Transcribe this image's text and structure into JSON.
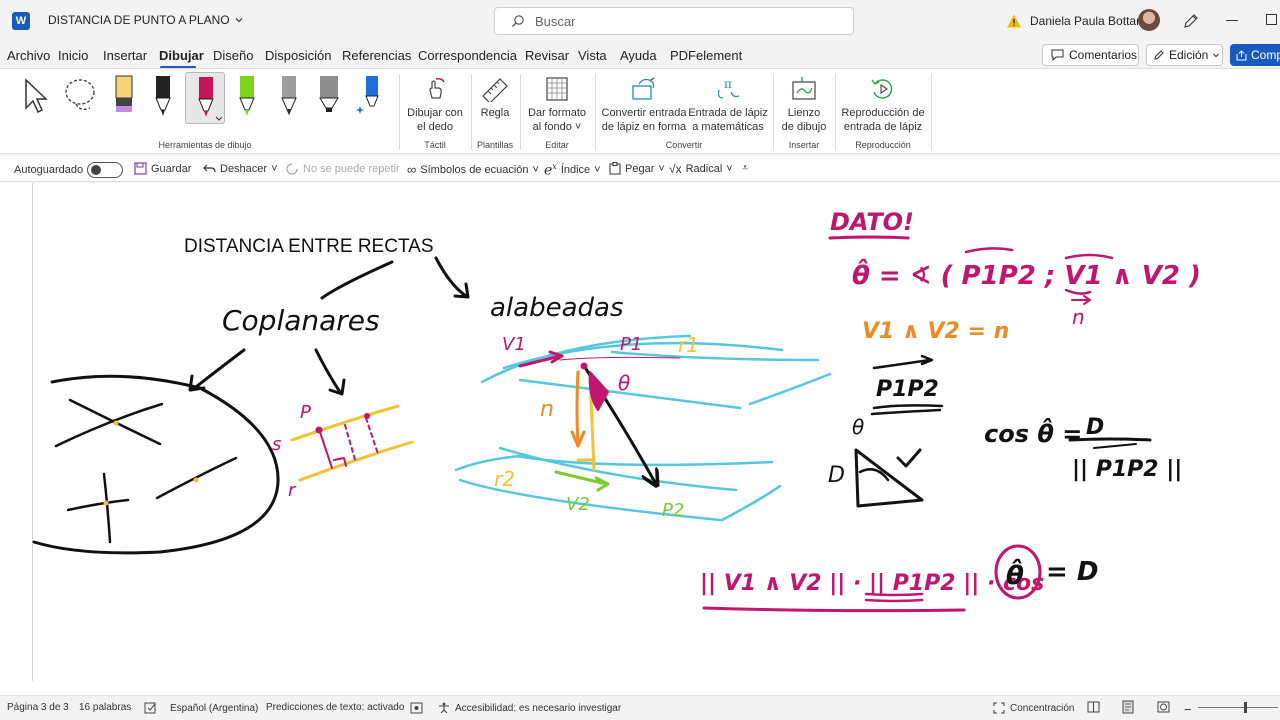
{
  "app": {
    "logo": "W",
    "doc_title": "DISTANCIA DE PUNTO A PLANO",
    "search_placeholder": "Buscar",
    "user_name": "Daniela Paula Bottaro"
  },
  "menu": {
    "tabs": [
      "Archivo",
      "Inicio",
      "Insertar",
      "Dibujar",
      "Diseño",
      "Disposición",
      "Referencias",
      "Correspondencia",
      "Revisar",
      "Vista",
      "Ayuda",
      "PDFelement"
    ],
    "active_tab": "Dibujar",
    "comments_label": "Comentarios",
    "edit_label": "Edición",
    "share_label": "Comp"
  },
  "ribbon": {
    "groups": {
      "herramientas": "Herramientas de dibujo",
      "tactil": "Táctil",
      "plantillas": "Plantillas",
      "editar": "Editar",
      "convertir": "Convertir",
      "insertar": "Insertar",
      "reproduccion": "Reproducción"
    },
    "buttons": {
      "dibujar_dedo_1": "Dibujar con",
      "dibujar_dedo_2": "el dedo",
      "regla": "Regla",
      "dar_formato_1": "Dar formato",
      "dar_formato_2": "al fondo",
      "convertir_forma_1": "Convertir entrada",
      "convertir_forma_2": "de lápiz en forma",
      "entrada_mate_1": "Entrada de lápiz",
      "entrada_mate_2": "a matemáticas",
      "lienzo_1": "Lienzo",
      "lienzo_2": "de dibujo",
      "reproduccion_1": "Reproducción de",
      "reproduccion_2": "entrada de lápiz"
    },
    "pen_colors": [
      "#f5d37a",
      "#c2185b",
      "#7ed321",
      "#9e9e9e",
      "#8e8e8e",
      "#1e6fd9"
    ]
  },
  "qat": {
    "autoguardado": "Autoguardado",
    "guardar": "Guardar",
    "deshacer": "Deshacer",
    "rehacer": "No se puede repetir",
    "simbolos": "Símbolos de ecuación",
    "indice": "Índice",
    "pegar": "Pegar",
    "radical": "Radical"
  },
  "document": {
    "heading": "DISTANCIA ENTRE RECTAS",
    "ink_colors": {
      "magenta": "#c0166e",
      "orange": "#f08a24",
      "cyan": "#56c7dd",
      "yellow": "#f2c23a",
      "green": "#7ccc2e",
      "black": "#111111"
    },
    "handwriting": {
      "coplanares": "Coplanares",
      "alabeadas": "alabeadas",
      "v1": "V1",
      "p1": "P1",
      "r1": "r1",
      "theta": "θ",
      "n": "n",
      "r2": "r2",
      "v2": "V2",
      "p2": "P2",
      "P": "P",
      "s": "s",
      "r": "r",
      "dato": "DATO!",
      "theta_hat_def": "θ̂ = ∢ ( P1P2 ; V1 ∧ V2 )",
      "n_under": "n",
      "cross_eq": "V1 ∧ V2 = n",
      "p1p2": "P1P2",
      "tri_theta": "θ",
      "tri_D": "D",
      "cos_eq": "cos θ̂ =",
      "frac_num": "D",
      "frac_den": "|| P1P2 ||",
      "final_eq_left": "|| V1 ∧ V2 || · || P1P2 || · cos",
      "final_theta": "θ̂",
      "final_eq_right": "= D"
    }
  },
  "status": {
    "page": "Página 3 de 3",
    "words": "16 palabras",
    "language": "Español (Argentina)",
    "predictions": "Predicciones de texto: activado",
    "accessibility": "Accesibilidad: es necesario investigar",
    "focus": "Concentración"
  }
}
